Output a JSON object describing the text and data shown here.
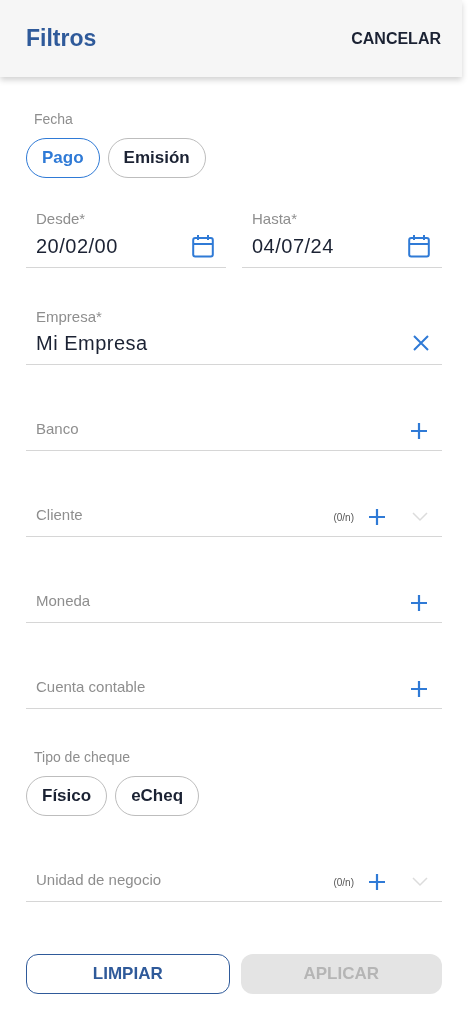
{
  "header": {
    "title": "Filtros",
    "action": "CANCELAR"
  },
  "date_type": {
    "label": "Fecha",
    "options": [
      {
        "label": "Pago",
        "selected": true
      },
      {
        "label": "Emisión",
        "selected": false
      }
    ]
  },
  "date_range": [
    {
      "label": "Desde*",
      "value": "20/02/00"
    },
    {
      "label": "Hasta*",
      "value": "04/07/24"
    }
  ],
  "company": {
    "label": "Empresa*",
    "value": "Mi Empresa"
  },
  "pickers": [
    {
      "kind": "single",
      "label": "Banco"
    },
    {
      "kind": "multi",
      "label": "Cliente",
      "counter": "(0/n)"
    },
    {
      "kind": "single",
      "label": "Moneda"
    },
    {
      "kind": "single",
      "label": "Cuenta contable"
    }
  ],
  "check_type": {
    "label": "Tipo de cheque",
    "options": [
      {
        "label": "Físico",
        "selected": false
      },
      {
        "label": "eCheq",
        "selected": false
      }
    ]
  },
  "business_unit": {
    "kind": "multi",
    "label": "Unidad de negocio",
    "counter": "(0/n)"
  },
  "buttons": [
    {
      "label": "LIMPIAR",
      "disabled": false
    },
    {
      "label": "APLICAR",
      "disabled": true
    }
  ]
}
